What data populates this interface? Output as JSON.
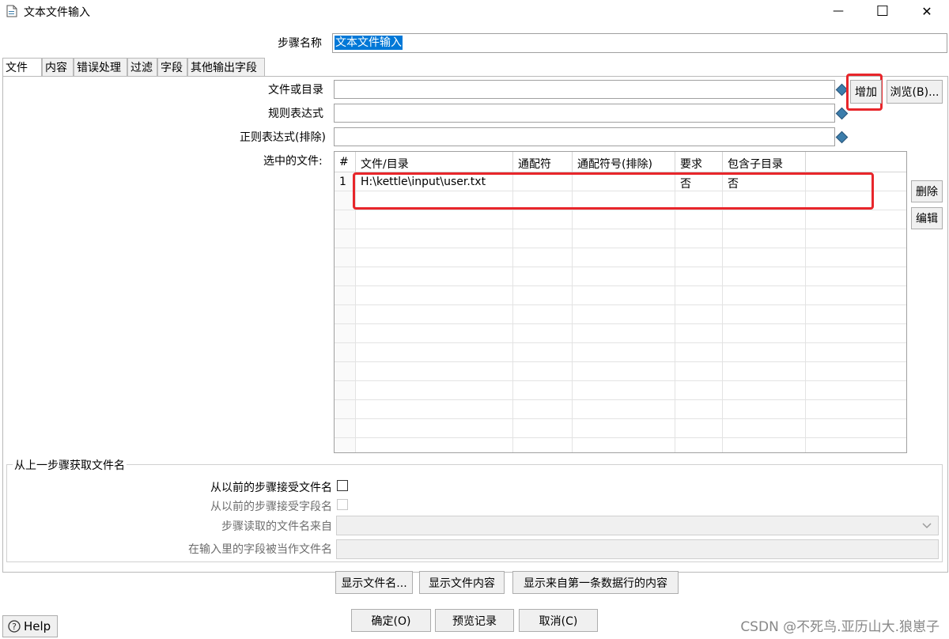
{
  "window": {
    "title": "文本文件输入",
    "minimize_glyph": "—",
    "maximize_glyph": "☐",
    "close_glyph": "✕"
  },
  "step": {
    "label": "步骤名称",
    "value": "文本文件输入"
  },
  "tabs": [
    {
      "label": "文件"
    },
    {
      "label": "内容"
    },
    {
      "label": "错误处理"
    },
    {
      "label": "过滤"
    },
    {
      "label": "字段"
    },
    {
      "label": "其他输出字段"
    }
  ],
  "file_section": {
    "file_or_dir_label": "文件或目录",
    "file_or_dir_value": "",
    "regex_label": "规则表达式",
    "regex_value": "",
    "regex_exclude_label": "正则表达式(排除)",
    "regex_exclude_value": "",
    "add_button": "增加",
    "browse_button": "浏览(B)...",
    "selected_files_label": "选中的文件:",
    "delete_button": "删除",
    "edit_button": "编辑"
  },
  "table": {
    "columns": [
      "#",
      "文件/目录",
      "通配符",
      "通配符号(排除)",
      "要求",
      "包含子目录"
    ],
    "rows": [
      [
        "1",
        "H:\\kettle\\input\\user.txt",
        "",
        "",
        "否",
        "否"
      ]
    ]
  },
  "prev_step": {
    "group_title": "从上一步骤获取文件名",
    "accept_filename_label": "从以前的步骤接受文件名",
    "accept_fieldname_label": "从以前的步骤接受字段名",
    "step_read_from_label": "步骤读取的文件名来自",
    "field_as_filename_label": "在输入里的字段被当作文件名"
  },
  "bottom_buttons": {
    "show_filenames": "显示文件名...",
    "show_file_content": "显示文件内容",
    "show_first_row": "显示来自第一条数据行的内容"
  },
  "footer": {
    "ok": "确定(O)",
    "preview": "预览记录",
    "cancel": "取消(C)",
    "help": "Help",
    "watermark": "CSDN @不死鸟.亚历山大.狼崽子"
  },
  "colors": {
    "accent_red": "#e8262b",
    "selection_blue": "#0078d7",
    "diamond_blue": "#3c7dab"
  }
}
